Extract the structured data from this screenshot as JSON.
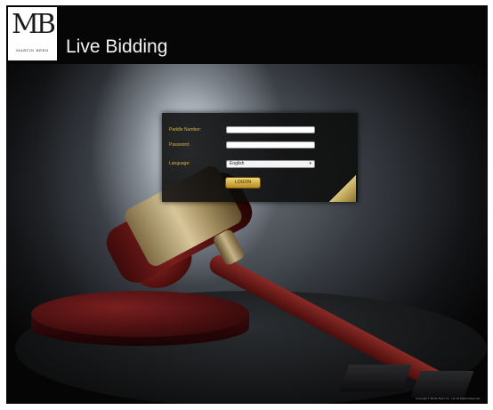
{
  "header": {
    "logo": {
      "mark": "MB",
      "subtext": "MARTIN BEEN"
    },
    "title": "Live Bidding"
  },
  "login": {
    "fields": [
      {
        "label": "Paddle Number:",
        "value": ""
      },
      {
        "label": "Password:",
        "value": ""
      }
    ],
    "language": {
      "label": "Language:",
      "selected": "English"
    },
    "submit_label": "LOGON"
  },
  "footer": {
    "copyright": "Copyright © Martin Been Co., Ltd. All Rights Reserved."
  },
  "colors": {
    "accent": "#d9b44a",
    "header_bg": "#060606"
  }
}
